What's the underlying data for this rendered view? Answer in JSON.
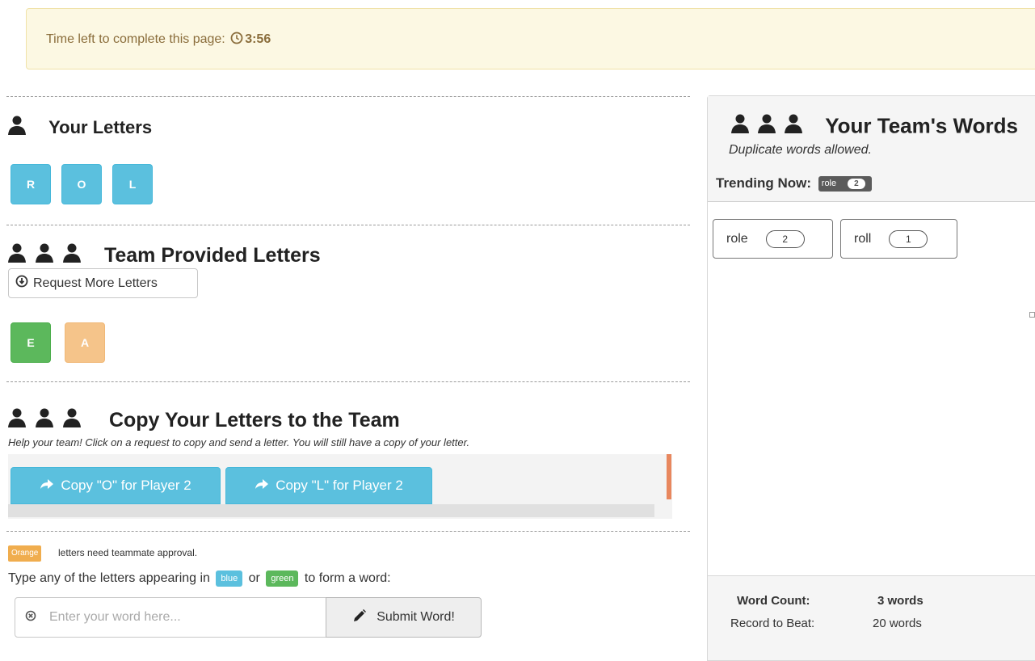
{
  "timer": {
    "label": "Time left to complete this page:",
    "value": "3:56",
    "icon": "clock-icon"
  },
  "your_letters": {
    "title": "Your Letters",
    "icon": "person-icon",
    "letters": [
      "R",
      "O",
      "L"
    ],
    "color": "#5bc0de"
  },
  "team_letters": {
    "title": "Team Provided Letters",
    "icon": "group-icon",
    "request_button": "Request More Letters",
    "letters": [
      {
        "letter": "E",
        "color": "green"
      },
      {
        "letter": "A",
        "color": "orange"
      }
    ]
  },
  "copy_letters": {
    "title": "Copy Your Letters to the Team",
    "help": "Help your team! Click on a request to copy and send a letter. You will still have a copy of your letter.",
    "buttons": [
      "Copy \"O\" for Player 2",
      "Copy \"L\" for Player 2"
    ]
  },
  "word_entry": {
    "orange_label": "Orange",
    "approval_text": "letters need teammate approval.",
    "instruction_before": "Type any of the letters appearing in",
    "blue_label": "blue",
    "or_text": "or",
    "green_label": "green",
    "instruction_after": "to form a word:",
    "placeholder": "Enter your word here...",
    "submit_label": "Submit Word!"
  },
  "team_words": {
    "title": "Your Team's Words",
    "subtitle": "Duplicate words allowed.",
    "trending_label": "Trending Now:",
    "trending": {
      "word": "role",
      "count": "2"
    },
    "words": [
      {
        "word": "role",
        "count": "2"
      },
      {
        "word": "roll",
        "count": "1"
      }
    ],
    "word_count_label": "Word Count:",
    "word_count_value": "3 words",
    "record_label": "Record to Beat:",
    "record_value": "20 words"
  },
  "colors": {
    "blue": "#5bc0de",
    "green": "#5cb85c",
    "orange": "#f0ad4e",
    "banner": "#fcf8e3"
  }
}
